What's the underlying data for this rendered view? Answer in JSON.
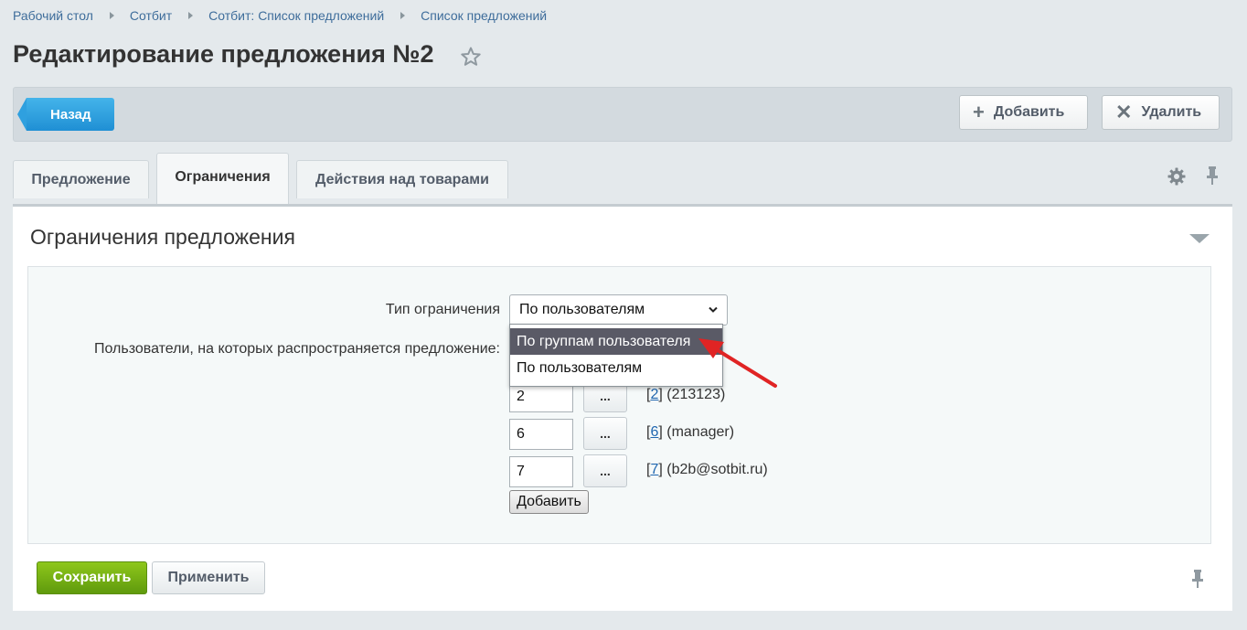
{
  "breadcrumb": [
    "Рабочий стол",
    "Сотбит",
    "Сотбит: Список предложений",
    "Список предложений"
  ],
  "page_title": "Редактирование предложения №2",
  "toolbar": {
    "back_label": "Назад",
    "add_label": "Добавить",
    "delete_label": "Удалить"
  },
  "tabs": [
    {
      "label": "Предложение"
    },
    {
      "label": "Ограничения"
    },
    {
      "label": "Действия над товарами"
    }
  ],
  "section": {
    "title": "Ограничения предложения",
    "type_label": "Тип ограничения",
    "type_value": "По пользователям",
    "type_options": [
      "По группам пользователя",
      "По пользователям"
    ],
    "users_label": "Пользователи, на которых распространяется предложение:",
    "users": [
      {
        "id": "2",
        "id_link": "2",
        "name": "(213123)"
      },
      {
        "id": "6",
        "id_link": "6",
        "name": "(manager)"
      },
      {
        "id": "7",
        "id_link": "7",
        "name": "(b2b@sotbit.ru)"
      }
    ],
    "pick_label": "...",
    "add_row_label": "Добавить"
  },
  "footer": {
    "save_label": "Сохранить",
    "apply_label": "Применить"
  },
  "colors": {
    "accent_blue": "#2fa0df",
    "save_green": "#7ab317",
    "arrow_red": "#e02424",
    "link": "#2067b0"
  }
}
